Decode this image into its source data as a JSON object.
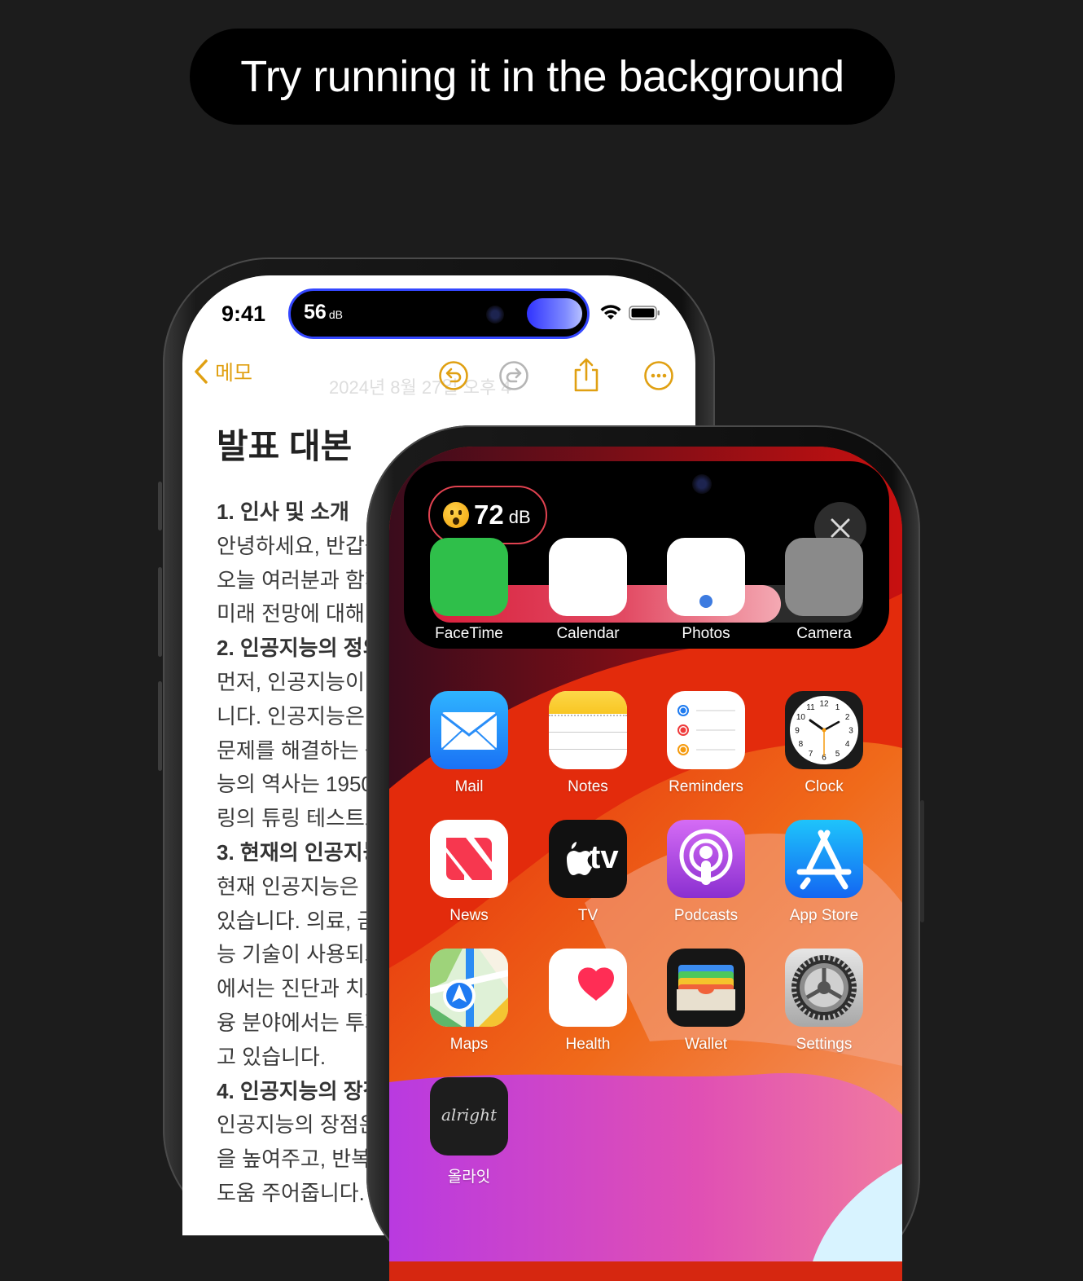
{
  "headline": "Try running it in the background",
  "notes_phone": {
    "time": "9:41",
    "island": {
      "value": "56",
      "unit": "dB"
    },
    "nav": {
      "back_label": "메모",
      "date": "2024년 8월 27일 오후 4"
    },
    "title": "발표 대본",
    "lines": [
      {
        "text": "1. 인사 및 소개",
        "heading": true
      },
      {
        "text": "안녕하세요, 반갑습",
        "heading": false
      },
      {
        "text": "오늘 여러분과 함께",
        "heading": false
      },
      {
        "text": "미래 전망에 대해",
        "heading": false
      },
      {
        "text": "2. 인공지능의 정의",
        "heading": true
      },
      {
        "text": "먼저, 인공지능이",
        "heading": false
      },
      {
        "text": "니다. 인공지능은",
        "heading": false
      },
      {
        "text": "문제를 해결하는 능",
        "heading": false
      },
      {
        "text": "능의 역사는 1950",
        "heading": false
      },
      {
        "text": "링의 튜링 테스트로",
        "heading": false
      },
      {
        "text": "3. 현재의 인공지능",
        "heading": true
      },
      {
        "text": "현재 인공지능은",
        "heading": false
      },
      {
        "text": "있습니다. 의료, 금",
        "heading": false
      },
      {
        "text": "능 기술이 사용되고",
        "heading": false
      },
      {
        "text": "에서는 진단과 치료",
        "heading": false
      },
      {
        "text": "융 분야에서는 투자",
        "heading": false
      },
      {
        "text": "고 있습니다.",
        "heading": false
      },
      {
        "text": "4. 인공지능의 장점",
        "heading": true
      },
      {
        "text": "인공지능의 장점은",
        "heading": false
      },
      {
        "text": "을 높여주고, 반복",
        "heading": false
      },
      {
        "text": "도움 주어줍니다.",
        "heading": false
      }
    ]
  },
  "home_phone": {
    "island": {
      "value": "72",
      "unit": "dB",
      "level_fraction": 0.81
    },
    "apps": [
      {
        "label": "FaceTime",
        "icon": "facetime-icon"
      },
      {
        "label": "Calendar",
        "icon": "calendar-icon"
      },
      {
        "label": "Photos",
        "icon": "photos-icon"
      },
      {
        "label": "Camera",
        "icon": "camera-icon"
      },
      {
        "label": "Mail",
        "icon": "mail-icon"
      },
      {
        "label": "Notes",
        "icon": "notes-icon"
      },
      {
        "label": "Reminders",
        "icon": "reminders-icon"
      },
      {
        "label": "Clock",
        "icon": "clock-icon"
      },
      {
        "label": "News",
        "icon": "news-icon"
      },
      {
        "label": "TV",
        "icon": "tv-icon",
        "glyph": "tv"
      },
      {
        "label": "Podcasts",
        "icon": "podcasts-icon"
      },
      {
        "label": "App Store",
        "icon": "app-store-icon"
      },
      {
        "label": "Maps",
        "icon": "maps-icon"
      },
      {
        "label": "Health",
        "icon": "health-icon"
      },
      {
        "label": "Wallet",
        "icon": "wallet-icon"
      },
      {
        "label": "Settings",
        "icon": "settings-icon"
      },
      {
        "label": "올라잇",
        "icon": "alright-icon",
        "glyph": "alright"
      }
    ],
    "clock_numbers": [
      "12",
      "1",
      "2",
      "3",
      "4",
      "5",
      "6",
      "7",
      "8",
      "9",
      "10",
      "11"
    ]
  }
}
